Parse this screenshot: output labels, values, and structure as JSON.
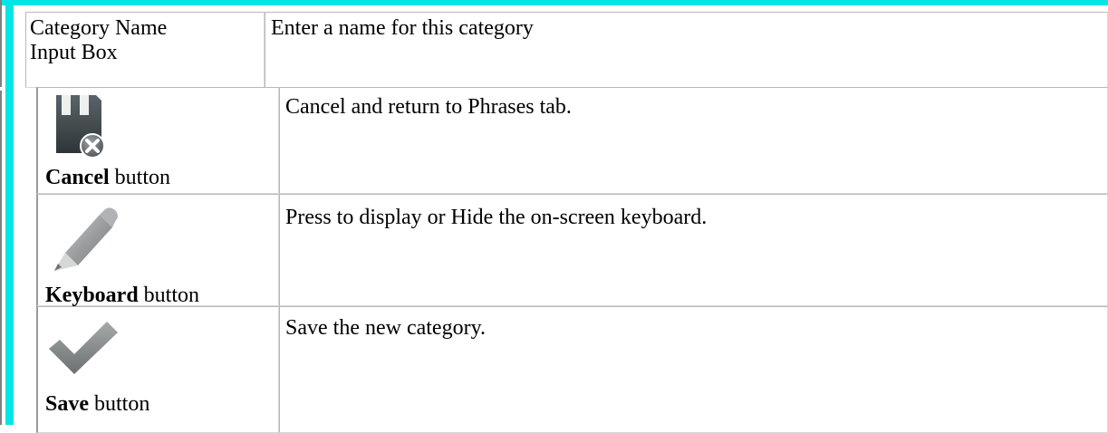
{
  "colors": {
    "accent": "#00e5e5",
    "border": "#b8b8b8"
  },
  "rows": [
    {
      "label_line1": "Category Name",
      "label_line2": "Input Box",
      "description": "Enter a name for this category"
    },
    {
      "icon": "save-cancel-icon",
      "label_bold": "Cancel",
      "label_rest": " button",
      "description": "Cancel and return to Phrases tab."
    },
    {
      "icon": "pencil-icon",
      "label_bold": "Keyboard",
      "label_rest": " button",
      "description": "Press to display or Hide the on-screen keyboard."
    },
    {
      "icon": "checkmark-icon",
      "label_bold": "Save",
      "label_rest": " button",
      "description": "Save the new category."
    }
  ]
}
